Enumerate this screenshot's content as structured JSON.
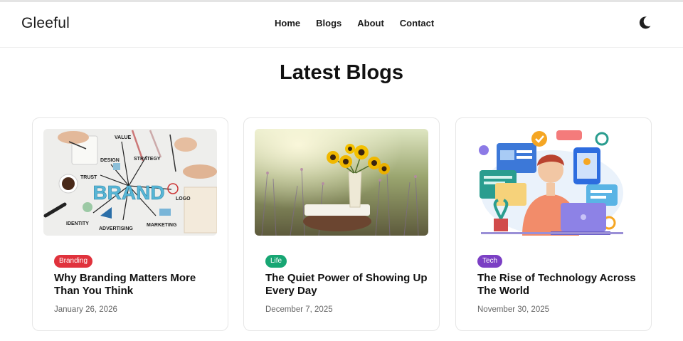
{
  "header": {
    "logo": "Gleeful",
    "nav": [
      "Home",
      "Blogs",
      "About",
      "Contact"
    ],
    "theme_icon": "moon-icon"
  },
  "main": {
    "heading": "Latest Blogs",
    "posts": [
      {
        "category": "Branding",
        "category_color": "#e0323c",
        "title": "Why Branding Matters More Than You Think",
        "date": "January 26, 2026",
        "image_words": {
          "brand": "BRAND",
          "value": "VALUE",
          "design": "DESIGN",
          "strategy": "STRATEGY",
          "trust": "TRUST",
          "logo": "LOGO",
          "identity": "IDENTITY",
          "advertising": "ADVERTISING",
          "marketing": "MARKETING"
        }
      },
      {
        "category": "Life",
        "category_color": "#17a673",
        "title": "The Quiet Power of Showing Up Every Day",
        "date": "December 7, 2025"
      },
      {
        "category": "Tech",
        "category_color": "#7b3fc4",
        "title": "The Rise of Technology Across The World",
        "date": "November 30, 2025"
      }
    ]
  }
}
